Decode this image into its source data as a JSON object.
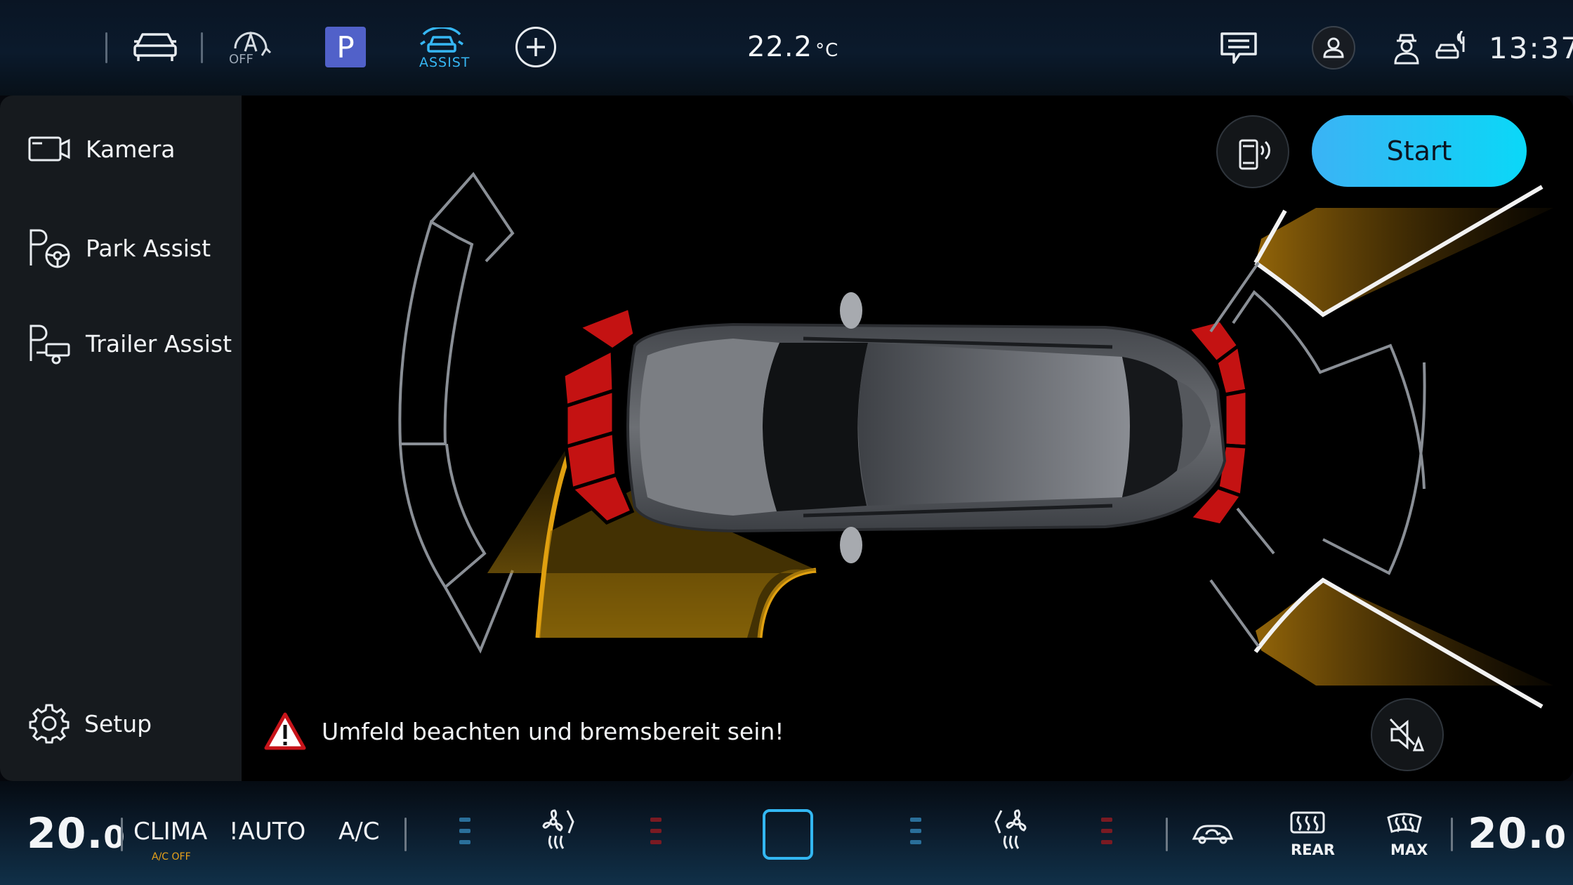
{
  "top_bar": {
    "icons": [
      "apps-grid-icon",
      "car-icon",
      "auto-start-stop-icon",
      "parking-icon",
      "assist-icon",
      "add-icon",
      "message-icon",
      "profile-icon",
      "driver-icon",
      "connectivity-icon"
    ],
    "auto_hold_label": "OFF",
    "park_label": "P",
    "assist_label": "ASSIST",
    "temperature": "22.2",
    "temperature_unit": "°C",
    "time": "13:37",
    "accent_color": "#36b7f4",
    "park_button_color": "#5161c9"
  },
  "sidebar": {
    "items": [
      {
        "label": "Kamera",
        "icon": "camera-icon"
      },
      {
        "label": "Park Assist",
        "icon": "park-assist-icon"
      },
      {
        "label": "Trailer Assist",
        "icon": "trailer-assist-icon"
      }
    ],
    "setup": {
      "label": "Setup",
      "icon": "gear-icon"
    }
  },
  "main": {
    "start_button_label": "Start",
    "start_button_color": "#1ec8f5",
    "phone_button_icon": "phone-remote-icon",
    "mute_button_icon": "mute-icon",
    "warning_text": "Umfeld beachten und bremsbereit sein!",
    "warning_icon": "warning-icon",
    "sensor_colors": {
      "near": "#c41212",
      "path": "#e0a010"
    }
  },
  "bottom_bar": {
    "left_temp_int": "20.",
    "left_temp_dec": "0",
    "clima_label": "CLIMA",
    "ac_status": "A/C OFF",
    "auto_label": "!AUTO",
    "ac_label": "A/C",
    "rear_label": "REAR",
    "max_label": "MAX",
    "right_temp_int": "20.",
    "right_temp_dec": "0",
    "icons": [
      "seat-fan-left-icon",
      "seat-fan-right-icon",
      "recirculation-icon",
      "rear-defrost-icon",
      "max-defrost-icon"
    ]
  }
}
